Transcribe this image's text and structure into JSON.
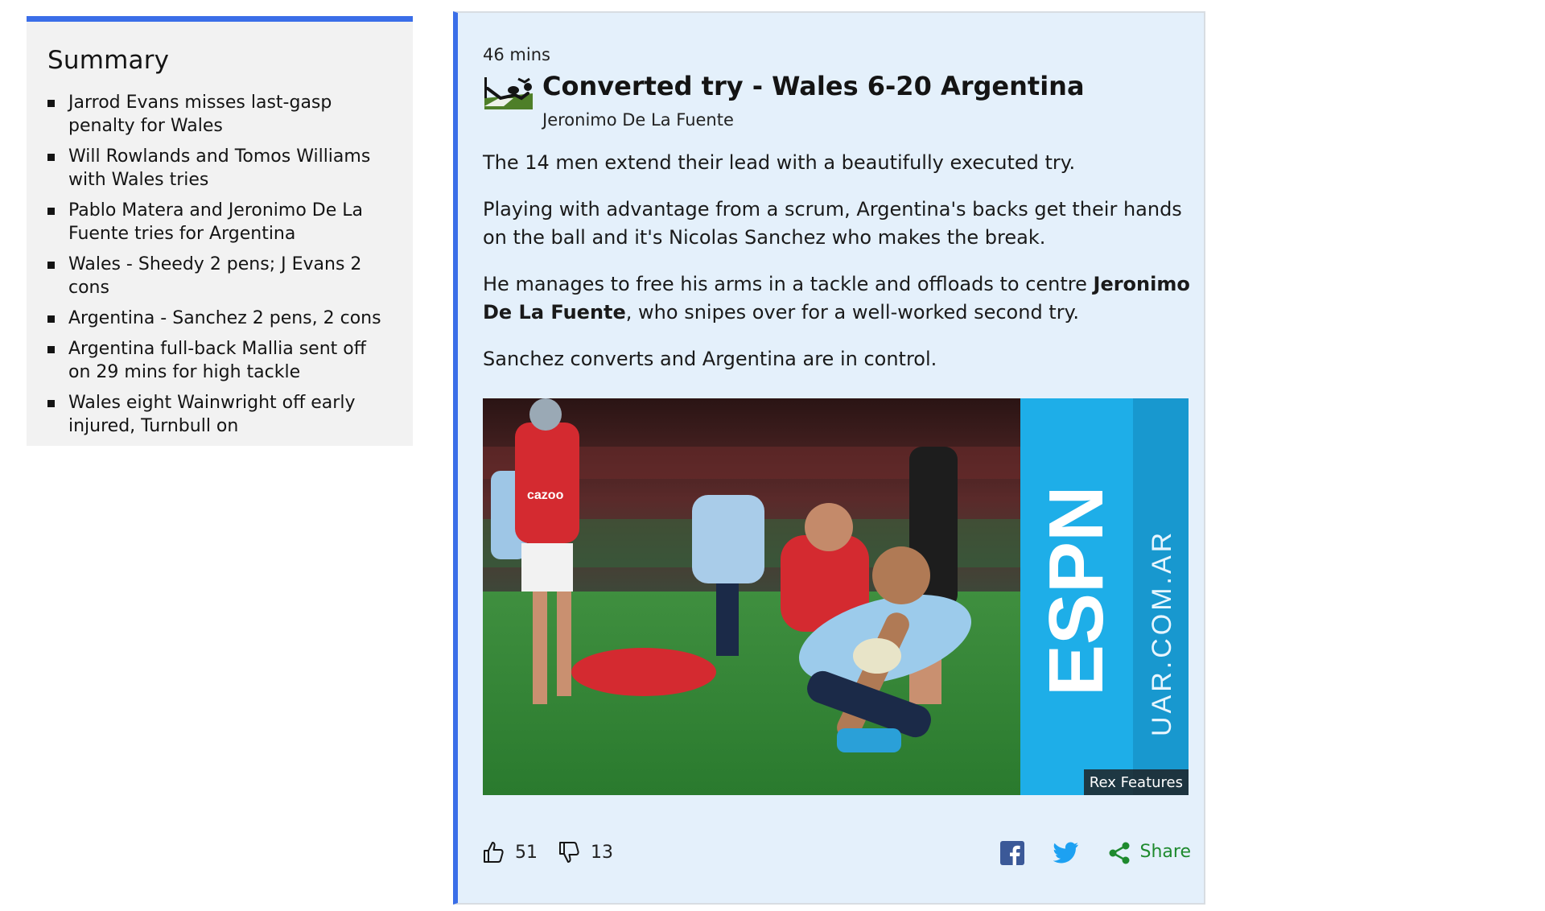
{
  "summary": {
    "title": "Summary",
    "items": [
      "Jarrod Evans misses last-gasp penalty for Wales",
      "Will Rowlands and Tomos Williams with Wales tries",
      "Pablo Matera and Jeronimo De La Fuente tries for Argentina",
      "Wales - Sheedy 2 pens; J Evans 2 cons",
      "Argentina - Sanchez 2 pens, 2 cons",
      "Argentina full-back Mallia sent off on 29 mins for high tackle",
      "Wales eight Wainwright off early injured, Turnbull on"
    ]
  },
  "post": {
    "time": "46 mins",
    "icon": "converted-try-icon",
    "headline": "Converted try - Wales 6-20 Argentina",
    "byline": "Jeronimo De La Fuente",
    "paragraphs": {
      "p1": "The 14 men extend their lead with a beautifully executed try.",
      "p2": "Playing with advantage from a scrum, Argentina's backs get their hands on the ball and it's Nicolas Sanchez who makes the break.",
      "p3_before": "He manages to free his arms in a tackle and offloads to centre ",
      "p3_bold": "Jeronimo De La Fuente",
      "p3_after": ", who snipes over for a well-worked second try.",
      "p4": "Sanchez converts and Argentina are in control."
    },
    "image_credit": "Rex Features",
    "image_board_text": "ESPN",
    "image_board_url_text": "UAR.COM.AR",
    "image_shirt_text": "cazoo",
    "likes": "51",
    "dislikes": "13",
    "share_label": "Share"
  },
  "colors": {
    "accent": "#3a6ee8",
    "post_bg": "#e4f0fb",
    "summary_bg": "#f2f2f2",
    "share_green": "#1e8a2e",
    "facebook": "#3b5998",
    "twitter": "#1da1f2"
  }
}
